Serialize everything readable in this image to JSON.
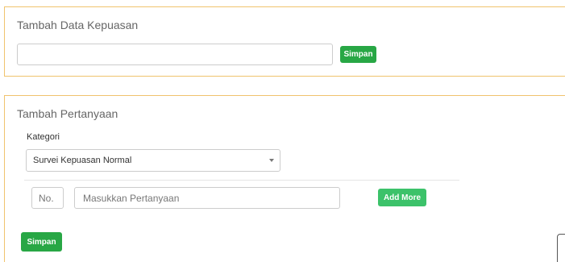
{
  "satisfaction_form": {
    "title": "Tambah Data Kepuasan",
    "input_value": "",
    "input_placeholder": "",
    "save_label": "Simpan"
  },
  "question_form": {
    "title": "Tambah Pertanyaan",
    "category_label": "Kategori",
    "category_selected": "Survei Kepuasan Normal",
    "number_placeholder": "No.",
    "question_placeholder": "Masukkan Pertanyaan",
    "add_more_label": "Add More",
    "save_label": "Simpan"
  },
  "colors": {
    "card_border": "#f0c36d",
    "button_green": "#28a745",
    "button_green_light": "#3cc26a"
  }
}
